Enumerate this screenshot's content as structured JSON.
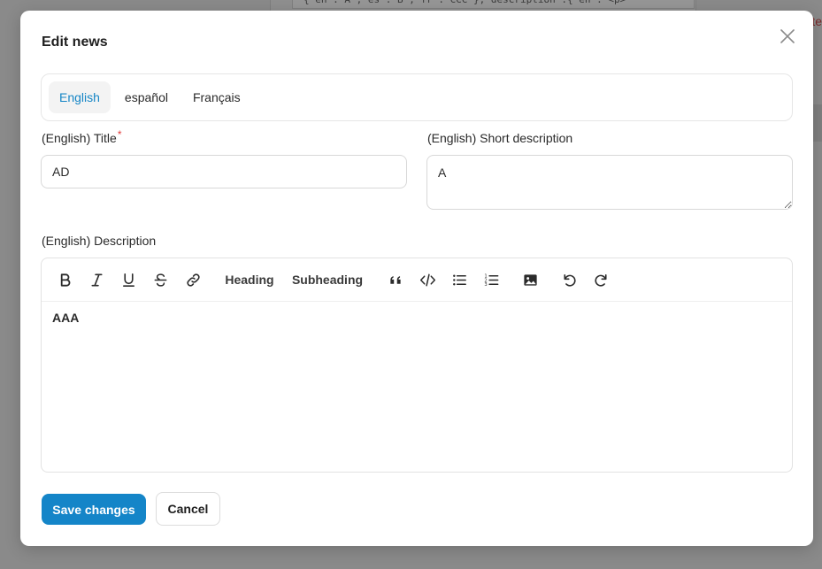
{
  "background": {
    "code_snippet": "{ en : A , es : B , fr : CCC }, description :{ en : <p>",
    "right_edge_text": "te"
  },
  "modal": {
    "title": "Edit news",
    "close_icon": "close-icon"
  },
  "language_tabs": [
    {
      "label": "English",
      "active": true
    },
    {
      "label": "español",
      "active": false
    },
    {
      "label": "Français",
      "active": false
    }
  ],
  "fields": {
    "title_label": "(English) Title",
    "title_required_mark": "*",
    "title_value": "AD",
    "short_description_label": "(English) Short description",
    "short_description_value": "A",
    "description_label": "(English) Description"
  },
  "editor": {
    "toolbar": {
      "bold_icon": "bold-icon",
      "italic_icon": "italic-icon",
      "underline_icon": "underline-icon",
      "strikethrough_icon": "strikethrough-icon",
      "link_icon": "link-icon",
      "heading_label": "Heading",
      "subheading_label": "Subheading",
      "quote_icon": "quote-icon",
      "code_icon": "code-icon",
      "bullet_list_icon": "bullet-list-icon",
      "ordered_list_icon": "ordered-list-icon",
      "image_icon": "image-icon",
      "undo_icon": "undo-icon",
      "redo_icon": "redo-icon"
    },
    "content": "AAA"
  },
  "actions": {
    "save_label": "Save changes",
    "cancel_label": "Cancel"
  },
  "colors": {
    "primary": "#1485c8",
    "active_tab_text": "#1686c6",
    "required": "#e23a3a",
    "overlay": "#8d8d8d"
  }
}
